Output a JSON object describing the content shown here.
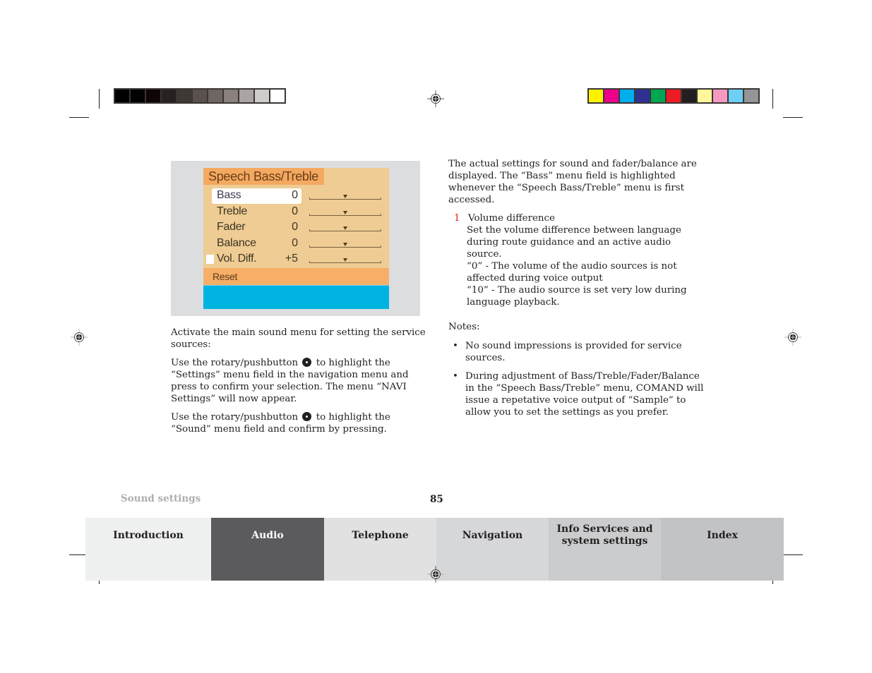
{
  "color_bars": {
    "grayscale": [
      "#000000",
      "#020202",
      "#0f0504",
      "#272220",
      "#3e3935",
      "#5a504d",
      "#6f6664",
      "#8a817f",
      "#aaa5a2",
      "#cfcbc9",
      "#ffffff"
    ],
    "process": [
      "#fff200",
      "#ec008c",
      "#00aeef",
      "#2e3192",
      "#00a651",
      "#ed1c24",
      "#231f20",
      "#fff799",
      "#f49ac1",
      "#6dcff6",
      "#939598"
    ]
  },
  "screen": {
    "title": "Speech Bass/Treble",
    "rows": [
      {
        "label": "Bass",
        "value": "0",
        "slider_position": 0.5,
        "selected": true
      },
      {
        "label": "Treble",
        "value": "0",
        "slider_position": 0.5,
        "selected": false
      },
      {
        "label": "Fader",
        "value": "0",
        "slider_position": 0.5,
        "selected": false
      },
      {
        "label": "Balance",
        "value": "0",
        "slider_position": 0.5,
        "selected": false
      },
      {
        "label": "Vol. Diff.",
        "value": "+5",
        "slider_position": 0.5,
        "selected": false
      }
    ],
    "reset_label": "Reset",
    "colors": {
      "panel": "#eecc93",
      "title_bar": "#f4a960",
      "reset_bar": "#f7ae66",
      "footer_bar": "#00b4e2"
    }
  },
  "left_column": {
    "p1": "Activate the main sound menu for setting the service sources:",
    "p2_before": "Use the rotary/pushbutton",
    "p2_after": "to highlight the “Settings” menu field in the navigation menu and press to confirm your selection. The menu “NAVI Settings” will now appear.",
    "p3_before": "Use the rotary/pushbutton",
    "p3_after": "to highlight the “Sound” menu field and confirm by pressing."
  },
  "right_column": {
    "intro": "The actual settings for sound and fader/balance are displayed. The “Bass” menu field is highlighted whenever the “Speech Bass/Treble” menu is first accessed.",
    "item_number": "1",
    "item_title": "Volume difference",
    "item_lines": [
      "Set the volume difference between language during route guidance and an active audio source.",
      "“0” - The volume of the audio sources is not affected during voice output",
      "“10” - The audio source is set very low during language playback."
    ],
    "notes_label": "Notes:",
    "bullet": "•",
    "notes": [
      "No sound impressions is provided for service sources.",
      "During adjustment of Bass/Treble/Fader/Balance in the “Speech Bass/Treble” menu, COMAND will issue a repetative voice output of “Sample” to allow you to set the settings as you prefer."
    ]
  },
  "footer": {
    "section": "Sound settings",
    "page": "85",
    "tabs": [
      {
        "label": "Introduction",
        "bg": "#eff0f0",
        "color": "#231f20",
        "active": false
      },
      {
        "label": "Audio",
        "bg": "#5b5b5d",
        "color": "#ffffff",
        "active": true
      },
      {
        "label": "Telephone",
        "bg": "#e1e1e2",
        "color": "#231f20",
        "active": false
      },
      {
        "label": "Navigation",
        "bg": "#d6d7d9",
        "color": "#231f20",
        "active": false
      },
      {
        "label": "Info Services and system settings",
        "line1": "Info Services and",
        "line2": "system settings",
        "bg": "#cbcccd",
        "color": "#231f20",
        "active": false
      },
      {
        "label": "Index",
        "bg": "#c2c3c5",
        "color": "#231f20",
        "active": false
      }
    ]
  }
}
